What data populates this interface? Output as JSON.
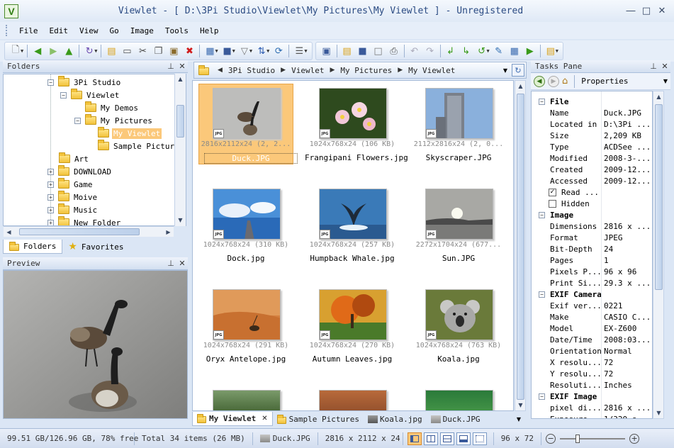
{
  "window": {
    "title": "Viewlet - [ D:\\3Pi Studio\\Viewlet\\My Pictures\\My Viewlet ] - Unregistered",
    "icon_letter": "V"
  },
  "menu": [
    "File",
    "Edit",
    "View",
    "Go",
    "Image",
    "Tools",
    "Help"
  ],
  "folders_panel": {
    "title": "Folders",
    "tree": [
      {
        "label": "3Pi Studio",
        "toggle": "−",
        "level": 0
      },
      {
        "label": "Viewlet",
        "toggle": "−",
        "level": 1
      },
      {
        "label": "My Demos",
        "toggle": "",
        "level": 2
      },
      {
        "label": "My Pictures",
        "toggle": "−",
        "level": 2
      },
      {
        "label": "My Viewlet",
        "toggle": "",
        "level": 3,
        "selected": true
      },
      {
        "label": "Sample Picture",
        "toggle": "",
        "level": 3
      },
      {
        "label": "Art",
        "toggle": "",
        "level": 0
      },
      {
        "label": "DOWNLOAD",
        "toggle": "+",
        "level": 0
      },
      {
        "label": "Game",
        "toggle": "+",
        "level": 0
      },
      {
        "label": "Moive",
        "toggle": "+",
        "level": 0
      },
      {
        "label": "Music",
        "toggle": "+",
        "level": 0
      },
      {
        "label": "New Folder",
        "toggle": "+",
        "level": 0
      }
    ],
    "tabs": {
      "folders": "Folders",
      "favorites": "Favorites"
    }
  },
  "preview_panel": {
    "title": "Preview"
  },
  "address": {
    "crumbs": [
      "3Pi Studio",
      "My Pictures",
      "My Viewlet"
    ],
    "crumb_viewlet": "Viewlet"
  },
  "files": [
    {
      "name": "Duck.JPG",
      "info": "2816x2112x24 (2, 2...",
      "selected": true,
      "badge": "JPG"
    },
    {
      "name": "Frangipani Flowers.jpg",
      "info": "1024x768x24 (106 KB)",
      "selected": false,
      "badge": "JPG"
    },
    {
      "name": "Skyscraper.JPG",
      "info": "2112x2816x24 (2, 0...",
      "selected": false,
      "badge": "JPG"
    },
    {
      "name": "Dock.jpg",
      "info": "1024x768x24 (310 KB)",
      "selected": false,
      "badge": "JPG"
    },
    {
      "name": "Humpback Whale.jpg",
      "info": "1024x768x24 (257 KB)",
      "selected": false,
      "badge": "JPG"
    },
    {
      "name": "Sun.JPG",
      "info": "2272x1704x24 (677...",
      "selected": false,
      "badge": "JPG"
    },
    {
      "name": "Oryx Antelope.jpg",
      "info": "1024x768x24 (291 KB)",
      "selected": false,
      "badge": "JPG"
    },
    {
      "name": "Autumn Leaves.jpg",
      "info": "1024x768x24 (270 KB)",
      "selected": false,
      "badge": "JPG"
    },
    {
      "name": "Koala.jpg",
      "info": "1024x768x24 (763 KB)",
      "selected": false,
      "badge": "JPG"
    }
  ],
  "doc_tabs": [
    "My Viewlet",
    "Sample Pictures",
    "Koala.jpg",
    "Duck.JPG"
  ],
  "tasks_pane": {
    "title": "Tasks Pane",
    "dropdown": "Properties",
    "groups": [
      {
        "title": "File",
        "rows": [
          {
            "key": "Name",
            "value": "Duck.JPG"
          },
          {
            "key": "Located in",
            "value": "D:\\3Pi ..."
          },
          {
            "key": "Size",
            "value": "2,209 KB"
          },
          {
            "key": "Type",
            "value": "ACDSee ..."
          },
          {
            "key": "Modified",
            "value": "2008-3-..."
          },
          {
            "key": "Created",
            "value": "2009-12..."
          },
          {
            "key": "Accessed",
            "value": "2009-12..."
          }
        ]
      },
      {
        "title": "Image",
        "rows": [
          {
            "key": "Dimensions",
            "value": "2816 x ..."
          },
          {
            "key": "Format",
            "value": "JPEG"
          },
          {
            "key": "Bit-Depth",
            "value": "24"
          },
          {
            "key": "Pages",
            "value": "1"
          },
          {
            "key": "Pixels P...",
            "value": "96 x 96"
          },
          {
            "key": "Print Si...",
            "value": "29.3 x ..."
          }
        ]
      },
      {
        "title": "EXIF Camera",
        "rows": [
          {
            "key": "Exif ver...",
            "value": "0221"
          },
          {
            "key": "Make",
            "value": "CASIO C..."
          },
          {
            "key": "Model",
            "value": "EX-Z600"
          },
          {
            "key": "Date/Time",
            "value": "2008:03..."
          },
          {
            "key": "Orientation",
            "value": "Normal"
          },
          {
            "key": "X resolu...",
            "value": "72"
          },
          {
            "key": "Y resolu...",
            "value": "72"
          },
          {
            "key": "Resoluti...",
            "value": "Inches"
          }
        ]
      },
      {
        "title": "EXIF Image",
        "rows": [
          {
            "key": "pixel di...",
            "value": "2816 x ..."
          },
          {
            "key": "Exposure...",
            "value": "1/320 s"
          }
        ]
      }
    ],
    "checkboxes": [
      {
        "label": "Read ...",
        "checked": true
      },
      {
        "label": "Hidden",
        "checked": false
      }
    ]
  },
  "status": {
    "disk": "99.51 GB/126.96 GB, 78% free",
    "total": "Total 34 items (26 MB)",
    "file": "Duck.JPG",
    "dims": "2816 x 2112 x 24",
    "thumb_size": "96 x 72"
  },
  "colors": {
    "accent": "#fbc87a",
    "frame": "#dbe6f5"
  }
}
